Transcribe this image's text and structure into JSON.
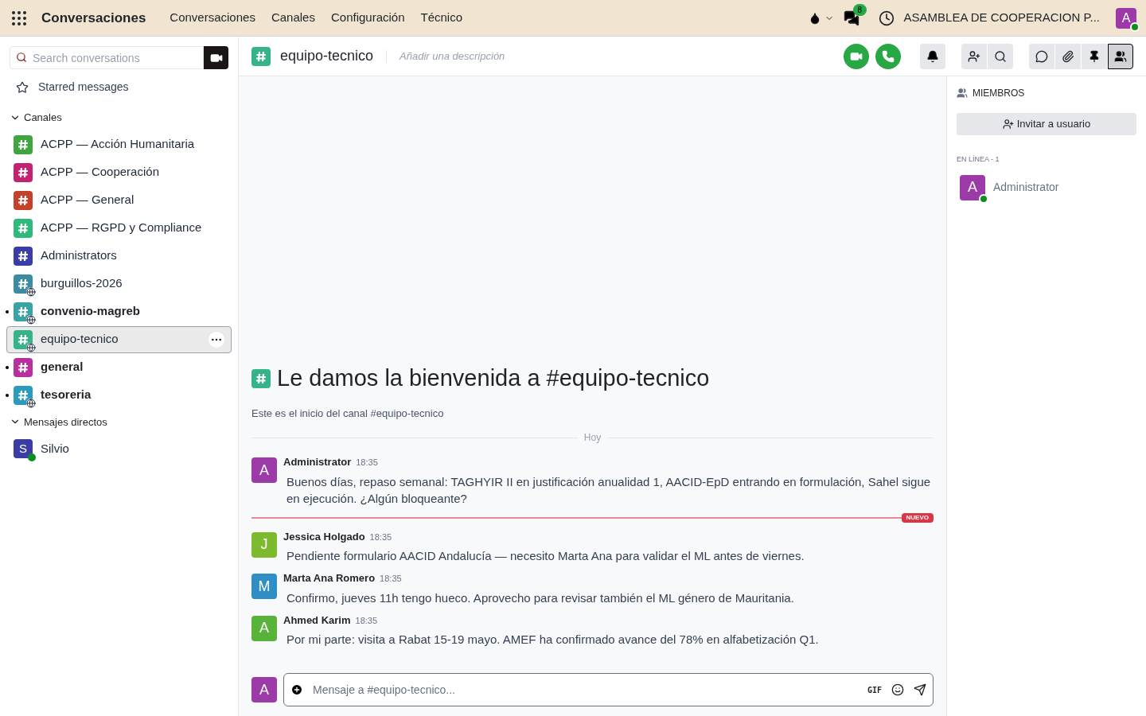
{
  "topbar": {
    "app_title": "Conversaciones",
    "menu": [
      "Conversaciones",
      "Canales",
      "Configuración",
      "Técnico"
    ],
    "message_badge": "8",
    "company": "ASAMBLEA DE COOPERACION P...",
    "user_initial": "A",
    "user_online": true
  },
  "sidebar": {
    "search": {
      "placeholder": "Search conversations"
    },
    "starred": "Starred messages",
    "sections": [
      {
        "title": "Canales",
        "expanded": true,
        "items": [
          {
            "kind": "channel",
            "label": "ACPP — Acción Humanitaria",
            "color": "#3fa63f",
            "public": false,
            "unread": false,
            "selected": false
          },
          {
            "kind": "channel",
            "label": "ACPP — Cooperación",
            "color": "#c2226f",
            "public": false,
            "unread": false,
            "selected": false
          },
          {
            "kind": "channel",
            "label": "ACPP — General",
            "color": "#c4412a",
            "public": false,
            "unread": false,
            "selected": false
          },
          {
            "kind": "channel",
            "label": "ACPP — RGPD y Compliance",
            "color": "#2fba7c",
            "public": false,
            "unread": false,
            "selected": false
          },
          {
            "kind": "channel",
            "label": "Administrators",
            "color": "#3a3da6",
            "public": false,
            "unread": false,
            "selected": false
          },
          {
            "kind": "channel",
            "label": "burguillos-2026",
            "color": "#3b8ba3",
            "public": true,
            "unread": false,
            "selected": false
          },
          {
            "kind": "channel",
            "label": "convenio-magreb",
            "color": "#3aa3a3",
            "public": true,
            "unread": true,
            "selected": false
          },
          {
            "kind": "channel",
            "label": "equipo-tecnico",
            "color": "#36b38a",
            "public": true,
            "unread": false,
            "selected": true
          },
          {
            "kind": "channel",
            "label": "general",
            "color": "#b8309e",
            "public": false,
            "unread": true,
            "selected": false
          },
          {
            "kind": "channel",
            "label": "tesoreria",
            "color": "#2b9bbd",
            "public": true,
            "unread": true,
            "selected": false
          }
        ]
      },
      {
        "title": "Mensajes directos",
        "expanded": true,
        "items": [
          {
            "kind": "direct",
            "label": "Silvio",
            "initial": "S",
            "color": "#3a3da6",
            "online": true,
            "unread": false,
            "selected": false
          }
        ]
      }
    ]
  },
  "channel": {
    "name": "equipo-tecnico",
    "description_placeholder": "Añadir una descripción",
    "welcome_title": "Le damos la bienvenida a #equipo-tecnico",
    "welcome_subtitle": "Este es el inicio del canal #equipo-tecnico",
    "day_separator": "Hoy",
    "new_label": "NUEVO",
    "messages": [
      {
        "author": "Administrator",
        "initial": "A",
        "color": "#9c3aa8",
        "time": "18:35",
        "text": "Buenos días, repaso semanal: TAGHYIR II en justificación anualidad 1, AACID-EpD entrando en formulación, Sahel sigue en ejecución. ¿Algún bloqueante?",
        "new_after": true
      },
      {
        "author": "Jessica Holgado",
        "initial": "J",
        "color": "#7cba2e",
        "time": "18:35",
        "text": "Pendiente formulario AACID Andalucía — necesito Marta Ana para validar el ML antes de viernes.",
        "new_after": false
      },
      {
        "author": "Marta Ana Romero",
        "initial": "M",
        "color": "#2f8fc4",
        "time": "18:35",
        "text": "Confirmo, jueves 11h tengo hueco. Aprovecho para revisar también el ML género de Mauritania.",
        "new_after": false
      },
      {
        "author": "Ahmed Karim",
        "initial": "A",
        "color": "#58b33a",
        "time": "18:35",
        "text": "Por mi parte: visita a Rabat 15-19 mayo. AMEF ha confirmado avance del 78% en alfabetización Q1.",
        "new_after": false
      }
    ],
    "composer": {
      "placeholder": "Mensaje a #equipo-tecnico...",
      "user_initial": "A",
      "gif": "GIF"
    },
    "members_panel_open": true
  },
  "members": {
    "title": "MIEMBROS",
    "invite": "Invitar a usuario",
    "online_header": "EN LÍNEA - 1",
    "list": [
      {
        "name": "Administrator",
        "initial": "A",
        "color": "#9c3aa8",
        "online": true
      }
    ]
  }
}
